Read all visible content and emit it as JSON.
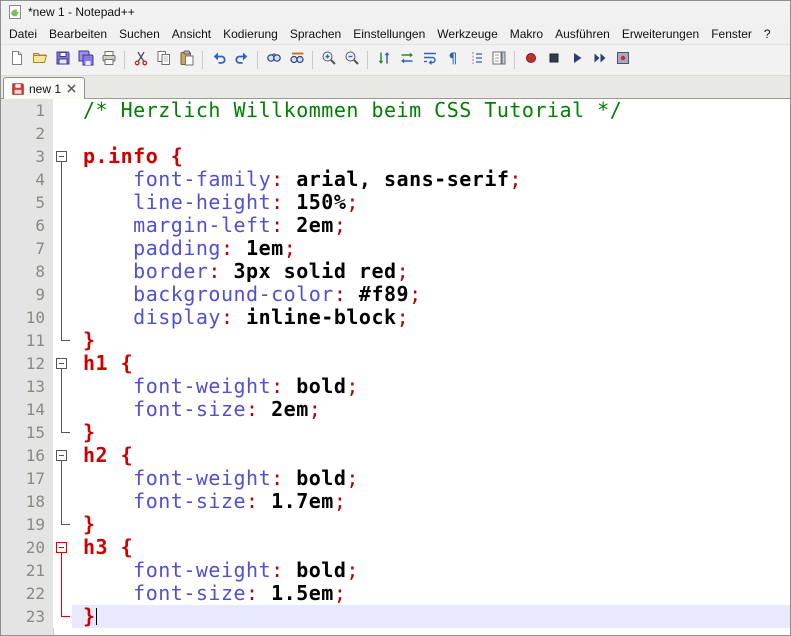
{
  "window": {
    "title": "*new 1 - Notepad++"
  },
  "menu": {
    "items": [
      "Datei",
      "Bearbeiten",
      "Suchen",
      "Ansicht",
      "Kodierung",
      "Sprachen",
      "Einstellungen",
      "Werkzeuge",
      "Makro",
      "Ausführen",
      "Erweiterungen",
      "Fenster",
      "?"
    ]
  },
  "toolbar": {
    "buttons": [
      "new-file",
      "open-folder",
      "save",
      "save-all",
      "print",
      "|",
      "cut",
      "copy",
      "paste",
      "|",
      "undo",
      "redo",
      "|",
      "find",
      "replace",
      "|",
      "zoom-in",
      "zoom-out",
      "|",
      "sync-scroll-vertical",
      "sync-scroll-horizontal",
      "word-wrap",
      "show-all-characters",
      "show-indent-guide",
      "document-map",
      "|",
      "record-macro",
      "stop-recording",
      "play-macro",
      "run-macro-multiple-times",
      "save-recorded-macro"
    ]
  },
  "tabbar": {
    "tabs": [
      {
        "label": "new 1",
        "active": true,
        "modified": true
      }
    ]
  },
  "editor": {
    "language": "CSS",
    "current_line": 23,
    "syntax_colors": {
      "comment": "#008000",
      "selector": "#cc0000",
      "property": "#5050d0",
      "value": "#000000",
      "punctuation": "#b00000",
      "current_line_bg": "#e8e8ff",
      "fold_active": "#e00000"
    },
    "lines": [
      {
        "n": 1,
        "fold": "",
        "hot": false,
        "tokens": [
          {
            "t": "/* Herzlich Willkommen beim CSS Tutorial */",
            "c": "comment"
          }
        ]
      },
      {
        "n": 2,
        "fold": "",
        "hot": false,
        "tokens": []
      },
      {
        "n": 3,
        "fold": "open",
        "hot": false,
        "tokens": [
          {
            "t": "p.info",
            "c": "sel"
          },
          {
            "t": " ",
            "c": "plain"
          },
          {
            "t": "{",
            "c": "sel"
          }
        ]
      },
      {
        "n": 4,
        "fold": "mid",
        "hot": false,
        "tokens": [
          {
            "t": "    ",
            "c": "plain"
          },
          {
            "t": "font-family",
            "c": "prop"
          },
          {
            "t": ":",
            "c": "punc"
          },
          {
            "t": " ",
            "c": "plain"
          },
          {
            "t": "arial, sans-serif",
            "c": "val"
          },
          {
            "t": ";",
            "c": "punc"
          }
        ]
      },
      {
        "n": 5,
        "fold": "mid",
        "hot": false,
        "tokens": [
          {
            "t": "    ",
            "c": "plain"
          },
          {
            "t": "line-height",
            "c": "prop"
          },
          {
            "t": ":",
            "c": "punc"
          },
          {
            "t": " ",
            "c": "plain"
          },
          {
            "t": "150%",
            "c": "val"
          },
          {
            "t": ";",
            "c": "punc"
          }
        ]
      },
      {
        "n": 6,
        "fold": "mid",
        "hot": false,
        "tokens": [
          {
            "t": "    ",
            "c": "plain"
          },
          {
            "t": "margin-left",
            "c": "prop"
          },
          {
            "t": ":",
            "c": "punc"
          },
          {
            "t": " ",
            "c": "plain"
          },
          {
            "t": "2em",
            "c": "val"
          },
          {
            "t": ";",
            "c": "punc"
          }
        ]
      },
      {
        "n": 7,
        "fold": "mid",
        "hot": false,
        "tokens": [
          {
            "t": "    ",
            "c": "plain"
          },
          {
            "t": "padding",
            "c": "prop"
          },
          {
            "t": ":",
            "c": "punc"
          },
          {
            "t": " ",
            "c": "plain"
          },
          {
            "t": "1em",
            "c": "val"
          },
          {
            "t": ";",
            "c": "punc"
          }
        ]
      },
      {
        "n": 8,
        "fold": "mid",
        "hot": false,
        "tokens": [
          {
            "t": "    ",
            "c": "plain"
          },
          {
            "t": "border",
            "c": "prop"
          },
          {
            "t": ":",
            "c": "punc"
          },
          {
            "t": " ",
            "c": "plain"
          },
          {
            "t": "3px solid red",
            "c": "val"
          },
          {
            "t": ";",
            "c": "punc"
          }
        ]
      },
      {
        "n": 9,
        "fold": "mid",
        "hot": false,
        "tokens": [
          {
            "t": "    ",
            "c": "plain"
          },
          {
            "t": "background-color",
            "c": "prop"
          },
          {
            "t": ":",
            "c": "punc"
          },
          {
            "t": " ",
            "c": "plain"
          },
          {
            "t": "#f89",
            "c": "val"
          },
          {
            "t": ";",
            "c": "punc"
          }
        ]
      },
      {
        "n": 10,
        "fold": "mid",
        "hot": false,
        "tokens": [
          {
            "t": "    ",
            "c": "plain"
          },
          {
            "t": "display",
            "c": "prop"
          },
          {
            "t": ":",
            "c": "punc"
          },
          {
            "t": " ",
            "c": "plain"
          },
          {
            "t": "inline-block",
            "c": "val"
          },
          {
            "t": ";",
            "c": "punc"
          }
        ]
      },
      {
        "n": 11,
        "fold": "end",
        "hot": false,
        "tokens": [
          {
            "t": "}",
            "c": "sel"
          }
        ]
      },
      {
        "n": 12,
        "fold": "open",
        "hot": false,
        "tokens": [
          {
            "t": "h1",
            "c": "sel"
          },
          {
            "t": " ",
            "c": "plain"
          },
          {
            "t": "{",
            "c": "sel"
          }
        ]
      },
      {
        "n": 13,
        "fold": "mid",
        "hot": false,
        "tokens": [
          {
            "t": "    ",
            "c": "plain"
          },
          {
            "t": "font-weight",
            "c": "prop"
          },
          {
            "t": ":",
            "c": "punc"
          },
          {
            "t": " ",
            "c": "plain"
          },
          {
            "t": "bold",
            "c": "val"
          },
          {
            "t": ";",
            "c": "punc"
          }
        ]
      },
      {
        "n": 14,
        "fold": "mid",
        "hot": false,
        "tokens": [
          {
            "t": "    ",
            "c": "plain"
          },
          {
            "t": "font-size",
            "c": "prop"
          },
          {
            "t": ":",
            "c": "punc"
          },
          {
            "t": " ",
            "c": "plain"
          },
          {
            "t": "2em",
            "c": "val"
          },
          {
            "t": ";",
            "c": "punc"
          }
        ]
      },
      {
        "n": 15,
        "fold": "end",
        "hot": false,
        "tokens": [
          {
            "t": "}",
            "c": "sel"
          }
        ]
      },
      {
        "n": 16,
        "fold": "open",
        "hot": false,
        "tokens": [
          {
            "t": "h2",
            "c": "sel"
          },
          {
            "t": " ",
            "c": "plain"
          },
          {
            "t": "{",
            "c": "sel"
          }
        ]
      },
      {
        "n": 17,
        "fold": "mid",
        "hot": false,
        "tokens": [
          {
            "t": "    ",
            "c": "plain"
          },
          {
            "t": "font-weight",
            "c": "prop"
          },
          {
            "t": ":",
            "c": "punc"
          },
          {
            "t": " ",
            "c": "plain"
          },
          {
            "t": "bold",
            "c": "val"
          },
          {
            "t": ";",
            "c": "punc"
          }
        ]
      },
      {
        "n": 18,
        "fold": "mid",
        "hot": false,
        "tokens": [
          {
            "t": "    ",
            "c": "plain"
          },
          {
            "t": "font-size",
            "c": "prop"
          },
          {
            "t": ":",
            "c": "punc"
          },
          {
            "t": " ",
            "c": "plain"
          },
          {
            "t": "1.7em",
            "c": "val"
          },
          {
            "t": ";",
            "c": "punc"
          }
        ]
      },
      {
        "n": 19,
        "fold": "end",
        "hot": false,
        "tokens": [
          {
            "t": "}",
            "c": "sel"
          }
        ]
      },
      {
        "n": 20,
        "fold": "open",
        "hot": true,
        "tokens": [
          {
            "t": "h3",
            "c": "sel"
          },
          {
            "t": " ",
            "c": "plain"
          },
          {
            "t": "{",
            "c": "sel"
          }
        ]
      },
      {
        "n": 21,
        "fold": "mid",
        "hot": true,
        "tokens": [
          {
            "t": "    ",
            "c": "plain"
          },
          {
            "t": "font-weight",
            "c": "prop"
          },
          {
            "t": ":",
            "c": "punc"
          },
          {
            "t": " ",
            "c": "plain"
          },
          {
            "t": "bold",
            "c": "val"
          },
          {
            "t": ";",
            "c": "punc"
          }
        ]
      },
      {
        "n": 22,
        "fold": "mid",
        "hot": true,
        "tokens": [
          {
            "t": "    ",
            "c": "plain"
          },
          {
            "t": "font-size",
            "c": "prop"
          },
          {
            "t": ":",
            "c": "punc"
          },
          {
            "t": " ",
            "c": "plain"
          },
          {
            "t": "1.5em",
            "c": "val"
          },
          {
            "t": ";",
            "c": "punc"
          }
        ]
      },
      {
        "n": 23,
        "fold": "end",
        "hot": true,
        "tokens": [
          {
            "t": "}",
            "c": "sel"
          }
        ]
      }
    ]
  }
}
